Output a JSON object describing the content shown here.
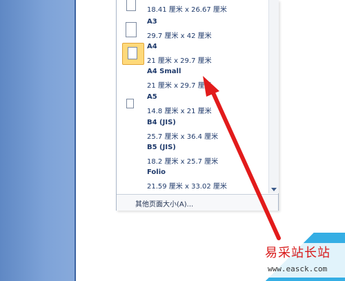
{
  "menu": {
    "items": [
      {
        "name": "",
        "size": "18.41 厘米 x 26.67 厘米",
        "selected": false
      },
      {
        "name": "A3",
        "size": "29.7 厘米 x 42 厘米",
        "selected": false
      },
      {
        "name": "A4",
        "size": "21 厘米 x 29.7 厘米",
        "selected": true
      },
      {
        "name": "A4 Small",
        "size": "21 厘米 x 29.7 厘米",
        "selected": false
      },
      {
        "name": "A5",
        "size": "14.8 厘米 x 21 厘米",
        "selected": false
      },
      {
        "name": "B4 (JIS)",
        "size": "25.7 厘米 x 36.4 厘米",
        "selected": false
      },
      {
        "name": "B5 (JIS)",
        "size": "18.2 厘米 x 25.7 厘米",
        "selected": false
      },
      {
        "name": "Folio",
        "size": "21.59 厘米 x 33.02 厘米",
        "selected": false
      }
    ],
    "more_sizes_label": "其他页面大小(A)..."
  },
  "watermark": {
    "cn_text": "易采站长站",
    "url": "www.easck.com"
  },
  "colors": {
    "arrow": "#e21b1b",
    "selection": "#ffd97a",
    "left_panel": "#7ea3d8"
  },
  "icons": {
    "page": "page-icon",
    "scroll_down": "chevron-down-icon"
  }
}
